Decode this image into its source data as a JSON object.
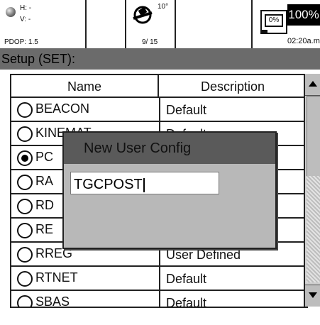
{
  "status": {
    "h_label": "H: -",
    "v_label": "V: -",
    "pdop": "PDOP: 1.5",
    "elevation": "10°",
    "satellites": "9/ 15",
    "memory_pct": "0%",
    "battery": "100%",
    "time": "02:20a.m"
  },
  "setup": {
    "title": "Setup (SET):"
  },
  "table": {
    "headers": {
      "name": "Name",
      "description": "Description"
    },
    "rows": [
      {
        "name": "BEACON",
        "description": "Default",
        "selected": false
      },
      {
        "name": "KINEMAT",
        "description": "Default",
        "selected": false
      },
      {
        "name": "PC",
        "description": "",
        "selected": true
      },
      {
        "name": "RA",
        "description": "",
        "selected": false
      },
      {
        "name": "RD",
        "description": "",
        "selected": false
      },
      {
        "name": "RE",
        "description": "",
        "selected": false
      },
      {
        "name": "RREG",
        "description": "User Defined",
        "selected": false
      },
      {
        "name": "RTNET",
        "description": "Default",
        "selected": false
      },
      {
        "name": "SBAS",
        "description": "Default",
        "selected": false
      }
    ]
  },
  "dialog": {
    "title": "New User Config",
    "input_value": "TGCPOST"
  },
  "icons": {
    "gps": "globe-icon",
    "satellite": "satellite-icon",
    "memory": "memory-gauge-icon",
    "scroll_up": "triangle-up-icon",
    "scroll_down": "triangle-down-icon"
  }
}
